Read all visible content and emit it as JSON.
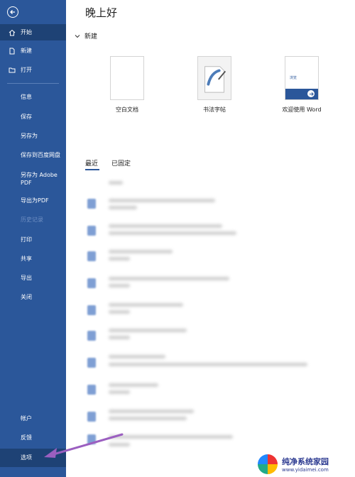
{
  "sidebar": {
    "items": [
      {
        "label": "开始",
        "icon": "home-icon",
        "active": true
      },
      {
        "label": "新建",
        "icon": "new-document-icon"
      },
      {
        "label": "打开",
        "icon": "folder-open-icon"
      },
      {
        "label": "信息"
      },
      {
        "label": "保存"
      },
      {
        "label": "另存为"
      },
      {
        "label": "保存到百度网盘"
      },
      {
        "label": "另存为 Adobe PDF"
      },
      {
        "label": "导出为PDF"
      },
      {
        "label": "历史记录",
        "disabled": true
      },
      {
        "label": "打印"
      },
      {
        "label": "共享"
      },
      {
        "label": "导出"
      },
      {
        "label": "关闭"
      }
    ],
    "bottom": [
      {
        "label": "帐户"
      },
      {
        "label": "反馈"
      },
      {
        "label": "选项",
        "active": true
      }
    ]
  },
  "main": {
    "greeting": "晚上好",
    "new_section": "新建",
    "templates": [
      {
        "label": "空白文档"
      },
      {
        "label": "书法字帖"
      },
      {
        "label": "欢迎使用 Word"
      }
    ],
    "welcome_tile_text": "浏览",
    "tabs": [
      {
        "label": "最近"
      },
      {
        "label": "已固定"
      }
    ]
  },
  "watermark": {
    "title": "纯净系统家园",
    "url": "www.yidaimei.com"
  },
  "colors": {
    "sidebar": "#2b579a",
    "active": "#1e4275",
    "arrow": "#9b5fc0"
  }
}
